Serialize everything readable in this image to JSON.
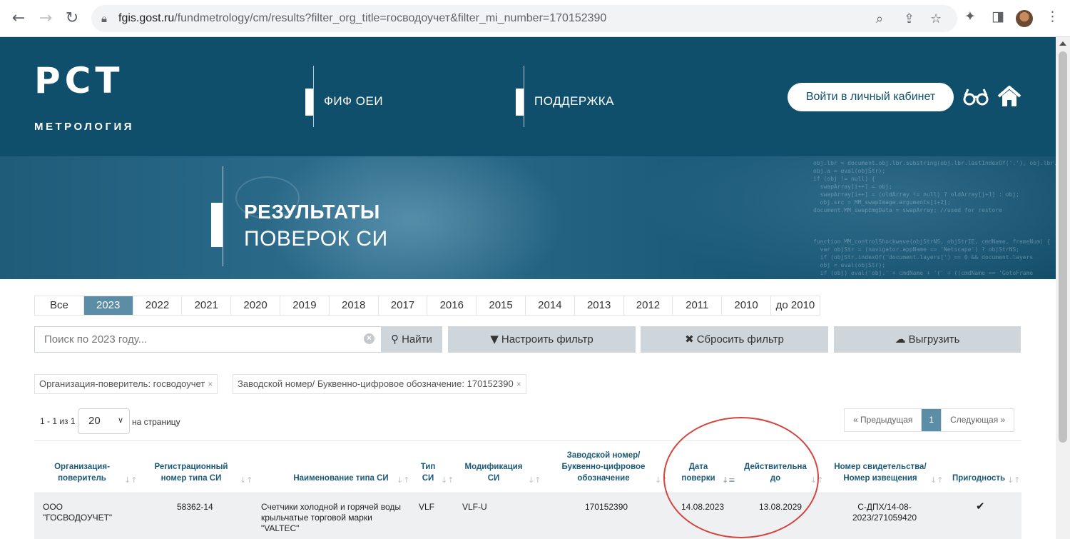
{
  "browser": {
    "url_domain": "fgis.gost.ru",
    "url_path": "/fundmetrology/cm/results?filter_org_title=госводоучет&filter_mi_number=170152390"
  },
  "header": {
    "logo_letters": "РСТ",
    "logo_sub": "МЕТРОЛОГИЯ",
    "menu": [
      "ФИФ ОЕИ",
      "ПОДДЕРЖКА"
    ],
    "login_label": "Войти в личный кабинет"
  },
  "banner": {
    "title_line1": "РЕЗУЛЬТАТЫ",
    "title_line2": "ПОВЕРОК СИ"
  },
  "years": [
    "Все",
    "2023",
    "2022",
    "2021",
    "2020",
    "2019",
    "2018",
    "2017",
    "2016",
    "2015",
    "2014",
    "2013",
    "2012",
    "2011",
    "2010",
    "до 2010"
  ],
  "active_year": "2023",
  "search": {
    "placeholder": "Поиск по 2023 году...",
    "find_label": "Найти",
    "filter_label": "Настроить фильтр",
    "reset_label": "Сбросить фильтр",
    "export_label": "Выгрузить"
  },
  "filters": [
    "Организация-поверитель: госводоучет",
    "Заводской номер/ Буквенно-цифровое обозначение: 170152390"
  ],
  "pagination": {
    "count": "1 - 1 из 1",
    "per_page": "20",
    "per_page_label": "на страницу",
    "prev": "Предыдущая",
    "current": "1",
    "next": "Следующая"
  },
  "table": {
    "headers": {
      "org": [
        "Организация-",
        "поверитель"
      ],
      "reg": [
        "Регистрационный",
        "номер типа СИ"
      ],
      "name": [
        "Наименование типа СИ"
      ],
      "type": [
        "Тип",
        "СИ"
      ],
      "mod": [
        "Модификация",
        "СИ"
      ],
      "serial": [
        "Заводской номер/",
        "Буквенно-цифровое",
        "обозначение"
      ],
      "date": [
        "Дата",
        "поверки"
      ],
      "valid": [
        "Действительна",
        "до"
      ],
      "cert": [
        "Номер свидетельства/",
        "Номер извещения"
      ],
      "fit": [
        "Пригодность"
      ]
    },
    "rows": [
      {
        "org": [
          "ООО",
          "\"ГОСВОДОУЧЕТ\""
        ],
        "reg": "58362-14",
        "name": [
          "Счетчики холодной и горячей воды",
          "крыльчатые торговой марки",
          "\"VALTEC\""
        ],
        "type": "VLF",
        "mod": "VLF-U",
        "serial": "170152390",
        "date": "14.08.2023",
        "valid": "13.08.2029",
        "cert": [
          "С-ДПХ/14-08-",
          "2023/271059420"
        ],
        "fit": "✔"
      }
    ]
  },
  "colors": {
    "header_bg": "#0f4f6c",
    "accent": "#5b8ea6",
    "annotation": "#d4453d"
  }
}
